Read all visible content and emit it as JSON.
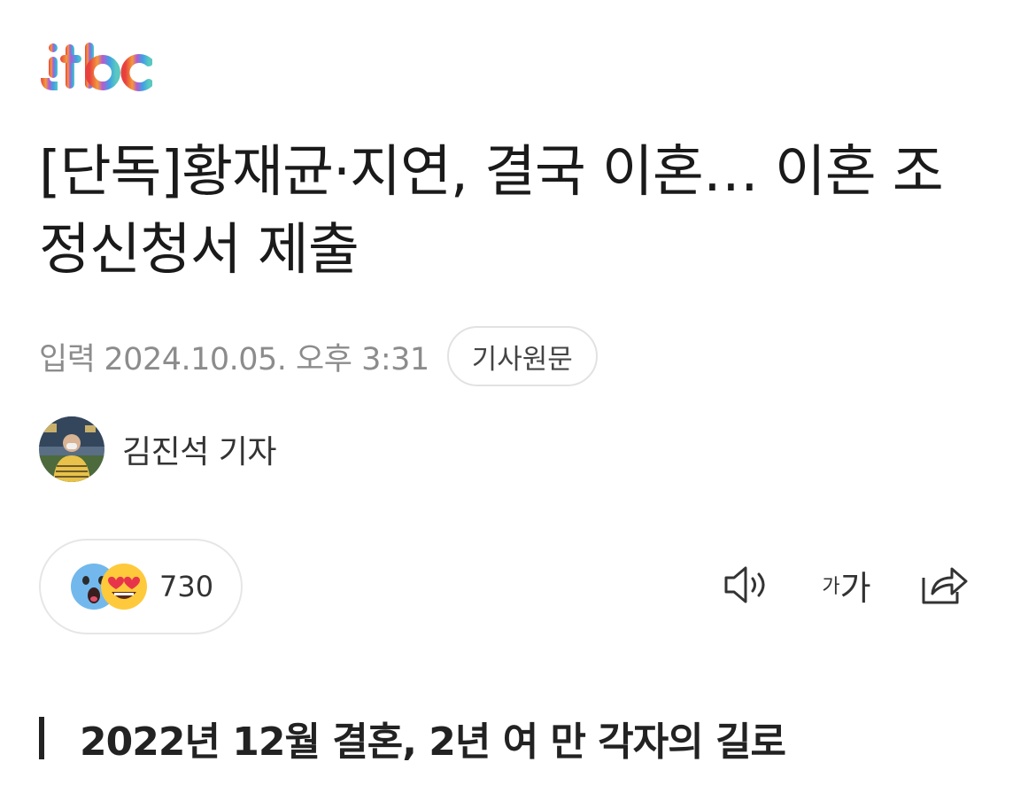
{
  "brand": {
    "name": "jtbc",
    "logo_icon": "jtbc-logo"
  },
  "article": {
    "title": "[단독]황재균·지연, 결국 이혼… 이혼 조정신청서 제출",
    "meta_label": "입력",
    "published": "2024.10.05. 오후 3:31",
    "origin_button": "기사원문",
    "reporter": {
      "name": "김진석 기자",
      "avatar_icon": "reporter-avatar"
    },
    "subheading": "2022년 12월 결혼, 2년 여 만 각자의 길로"
  },
  "reactions": {
    "icons": [
      "surprised-emoji-icon",
      "heart-eyes-emoji-icon"
    ],
    "count": "730"
  },
  "toolbar": {
    "tts_icon": "speaker-icon",
    "font_small": "가",
    "font_large": "가",
    "share_icon": "share-icon"
  },
  "colors": {
    "background": "#ffffff",
    "title": "#1a1a1a",
    "meta": "#8c8c8c",
    "border": "#e2e2e2"
  }
}
